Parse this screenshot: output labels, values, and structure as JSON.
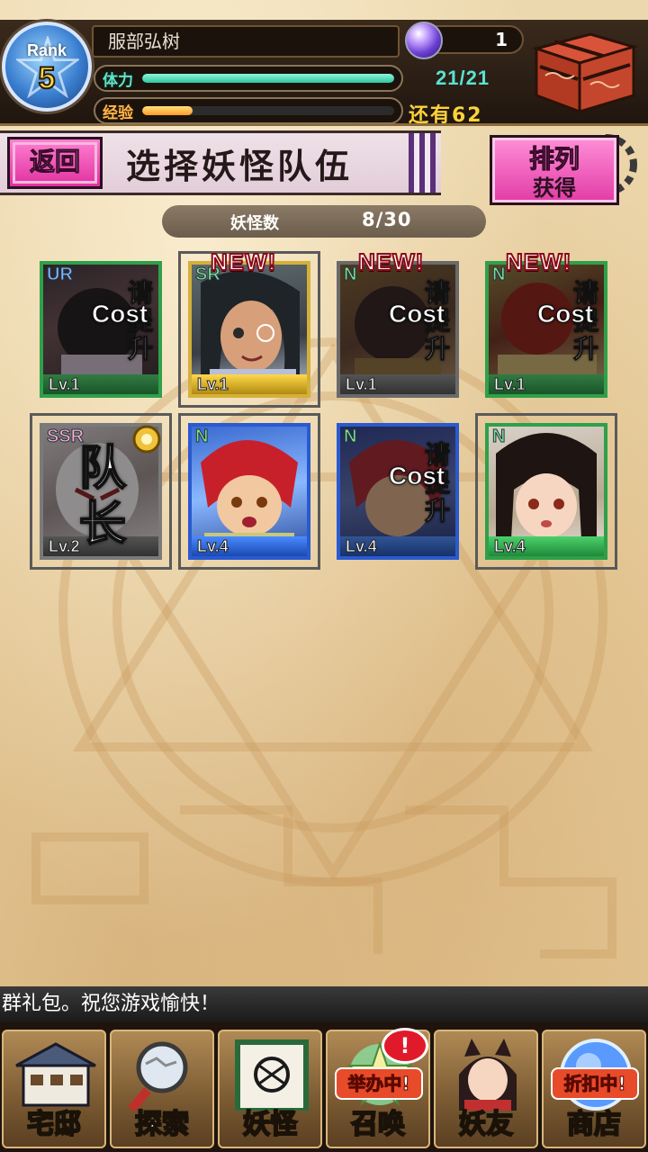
{
  "player": {
    "rank_label": "Rank",
    "rank_value": "5",
    "name": "服部弘树",
    "gems": "1",
    "stamina_label": "体力",
    "stamina_value": "21/21",
    "stamina_fraction": 1.0,
    "exp_label": "经验",
    "exp_remaining": "还有62",
    "exp_fraction": 0.2
  },
  "toolbar": {
    "back_label": "返回",
    "title": "选择妖怪队伍",
    "sort_line1": "排列",
    "sort_line2": "获得"
  },
  "yokai_count": {
    "label": "妖怪数",
    "value": "8/30"
  },
  "cards": [
    {
      "rarity": "UR",
      "level": "Lv.1",
      "new": "",
      "cost_text": "请提升",
      "cost_word": "Cost",
      "leader": ""
    },
    {
      "rarity": "SR",
      "level": "Lv.1",
      "new": "NEW!",
      "cost_text": "",
      "cost_word": "",
      "leader": ""
    },
    {
      "rarity": "N",
      "level": "Lv.1",
      "new": "NEW!",
      "cost_text": "请提升",
      "cost_word": "Cost",
      "leader": ""
    },
    {
      "rarity": "N",
      "level": "Lv.1",
      "new": "NEW!",
      "cost_text": "请提升",
      "cost_word": "Cost",
      "leader": ""
    },
    {
      "rarity": "SSR",
      "level": "Lv.2",
      "new": "",
      "cost_text": "",
      "cost_word": "",
      "leader": "队长"
    },
    {
      "rarity": "N",
      "level": "Lv.4",
      "new": "",
      "cost_text": "",
      "cost_word": "",
      "leader": ""
    },
    {
      "rarity": "N",
      "level": "Lv.4",
      "new": "",
      "cost_text": "请提升",
      "cost_word": "Cost",
      "leader": ""
    },
    {
      "rarity": "N",
      "level": "Lv.4",
      "new": "",
      "cost_text": "",
      "cost_word": "",
      "leader": ""
    }
  ],
  "ticker": "群礼包。祝您游戏愉快！",
  "nav": [
    {
      "label": "宅邸",
      "icon": "mansion-icon"
    },
    {
      "label": "探索",
      "icon": "magnifier-map-icon"
    },
    {
      "label": "妖怪",
      "icon": "scroll-icon"
    },
    {
      "label": "召唤",
      "icon": "summon-icon",
      "tag": "举办中!",
      "alert": "!"
    },
    {
      "label": "妖友",
      "icon": "fox-girl-icon"
    },
    {
      "label": "商店",
      "icon": "shop-orb-icon",
      "tag": "折扣中!"
    }
  ],
  "colors": {
    "accent_pink": "#e0309f",
    "stamina": "#2ec7a0",
    "exp": "#ff9a2a",
    "new_badge": "#8a0a1a"
  }
}
